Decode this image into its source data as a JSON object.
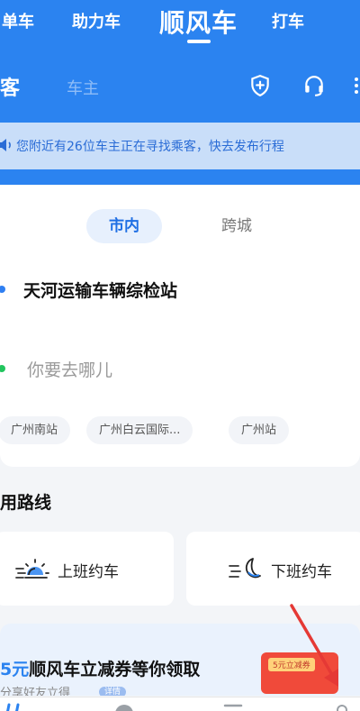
{
  "top_nav": {
    "tabs": [
      "单车",
      "助力车",
      "顺风车",
      "打车"
    ],
    "active_tab": "顺风车"
  },
  "role_tabs": {
    "passenger": "客",
    "driver": "车主"
  },
  "header_icons": [
    "shield-plus-icon",
    "headset-icon",
    "more-icon"
  ],
  "notice": {
    "icon": "speaker-icon",
    "text": "您附近有26位车主正在寻找乘客，快去发布行程"
  },
  "trip_type": {
    "options": [
      "市内",
      "跨城"
    ],
    "selected": "市内"
  },
  "route": {
    "from": "天河运输车辆综检站",
    "to_placeholder": "你要去哪儿"
  },
  "quick_destinations": [
    "广州南站",
    "广州白云国际...",
    "广州站"
  ],
  "common_routes": {
    "title": "用路线",
    "items": [
      {
        "label": "上班约车",
        "icon": "sun-commute-icon"
      },
      {
        "label": "下班约车",
        "icon": "moon-commute-icon"
      }
    ]
  },
  "promo": {
    "title_highlight": "5元",
    "title_rest": "顺风车立减券等你领取",
    "subtitle": "分享好友立得",
    "detail_label": "详情",
    "coupon_badge": "5元立减券"
  },
  "colors": {
    "brand_blue": "#2b83f0",
    "notice_bg": "#c9def9",
    "accent_red": "#e53935"
  }
}
